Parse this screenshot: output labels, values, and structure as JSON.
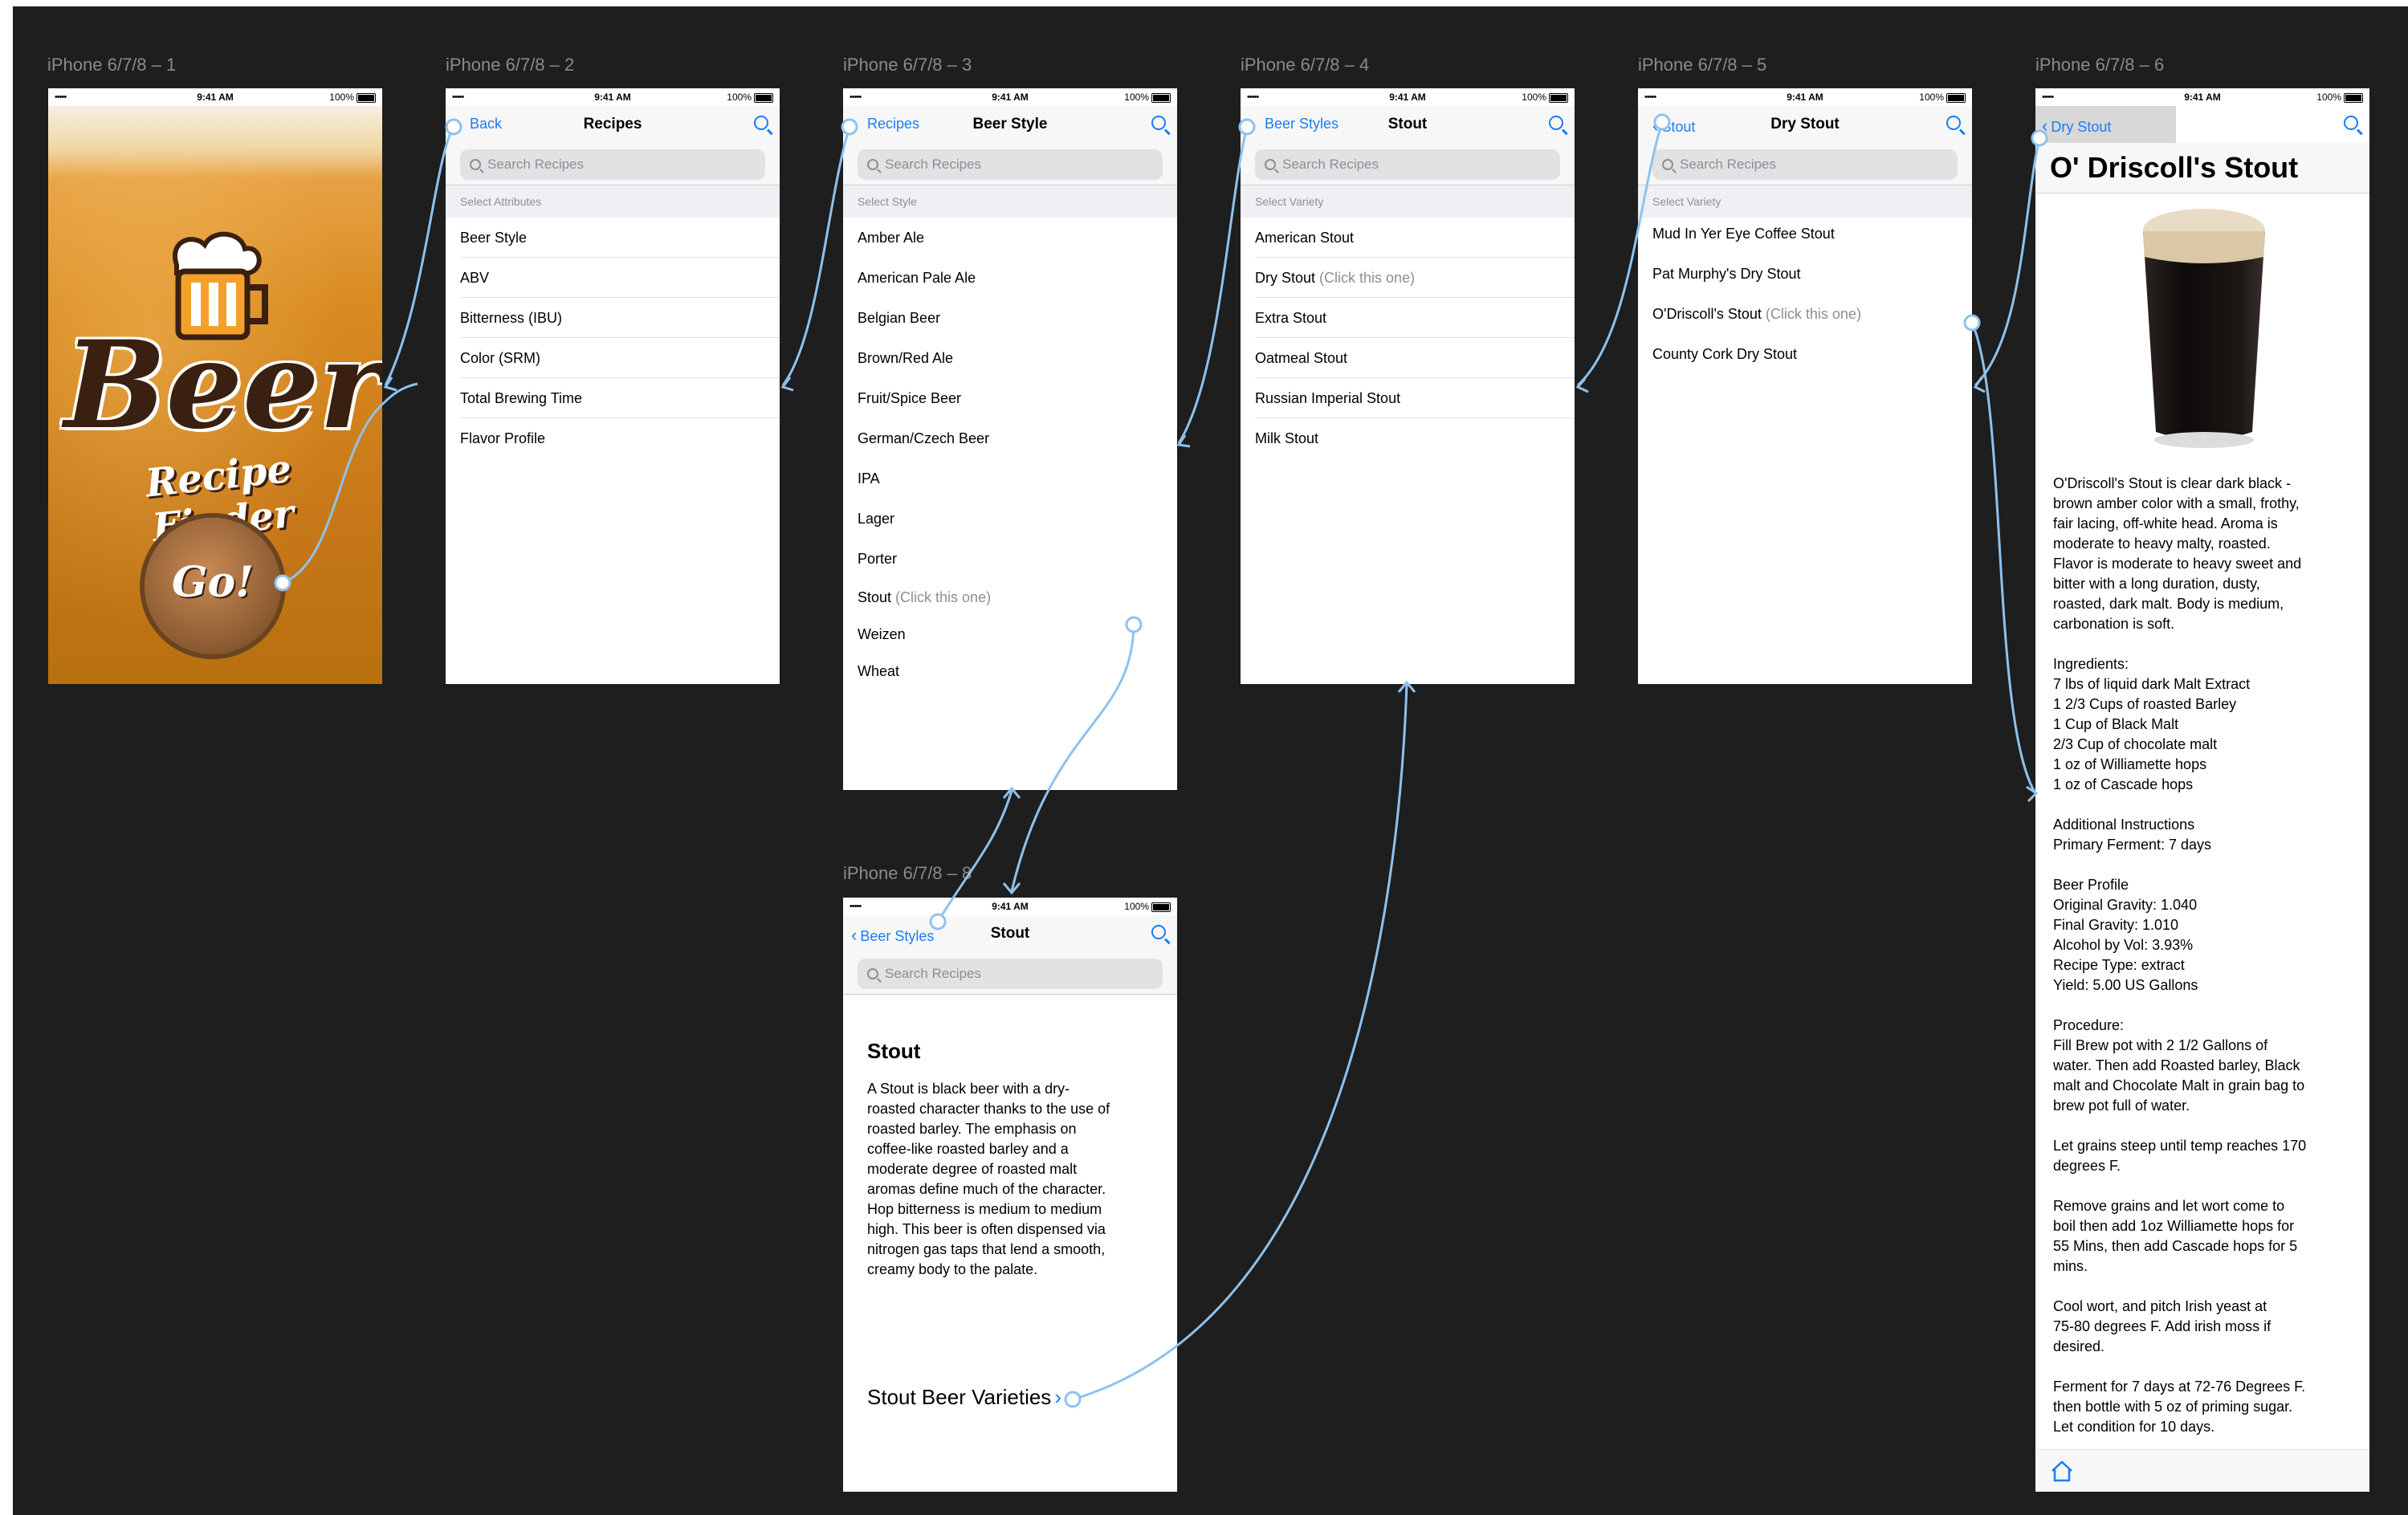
{
  "artboards": {
    "a1": "iPhone 6/7/8 – 1",
    "a2": "iPhone 6/7/8 – 2",
    "a3": "iPhone 6/7/8 – 3",
    "a4": "iPhone 6/7/8 – 4",
    "a5": "iPhone 6/7/8 – 5",
    "a6": "iPhone 6/7/8 – 6",
    "a8": "iPhone 6/7/8 – 8"
  },
  "status": {
    "time": "9:41 AM",
    "battery": "100%",
    "signal": "•••••"
  },
  "search_placeholder": "Search Recipes",
  "splash": {
    "logo_word": "Beer",
    "tagline": "Recipe Finder",
    "go_label": "Go!"
  },
  "screen2": {
    "back": "Back",
    "title": "Recipes",
    "section": "Select Attributes",
    "items": [
      "Beer Style",
      "ABV",
      "Bitterness (IBU)",
      "Color (SRM)",
      "Total Brewing Time",
      "Flavor Profile"
    ]
  },
  "screen3": {
    "back": "Recipes",
    "title": "Beer Style",
    "section": "Select Style",
    "items": [
      "Amber Ale",
      "American Pale Ale",
      "Belgian Beer",
      "Brown/Red Ale",
      "Fruit/Spice Beer",
      "German/Czech Beer",
      "IPA",
      "Lager",
      "Porter",
      "Stout",
      "Weizen",
      "Wheat"
    ],
    "stout_hint": "(Click this one)"
  },
  "screen4": {
    "back": "Beer Styles",
    "title": "Stout",
    "section": "Select Variety",
    "items": [
      "American Stout",
      "Dry Stout",
      "Extra Stout",
      "Oatmeal Stout",
      "Russian Imperial Stout",
      "Milk Stout"
    ],
    "dry_hint": "(Click this one)"
  },
  "screen5": {
    "back": "Stout",
    "title": "Dry Stout",
    "section": "Select Variety",
    "items": [
      "Mud In Yer Eye Coffee Stout",
      "Pat Murphy's Dry Stout",
      "O'Driscoll's Stout",
      "County Cork Dry Stout"
    ],
    "odriscoll_hint": "(Click this one)"
  },
  "screen6": {
    "back": "Dry Stout",
    "title": "O' Driscoll's Stout",
    "body": "O'Driscoll's Stout is clear dark black -\nbrown amber color with a small, frothy,\nfair lacing, off-white head. Aroma is\nmoderate to heavy malty, roasted.\nFlavor is moderate to heavy sweet and\nbitter with a long duration, dusty,\nroasted, dark malt. Body is medium,\ncarbonation is soft.\n\nIngredients:\n7 lbs of liquid dark Malt Extract\n1 2/3 Cups of roasted Barley\n1 Cup of Black Malt\n2/3 Cup of chocolate malt\n1 oz of Williamette hops\n1 oz of Cascade hops\n\nAdditional Instructions\nPrimary Ferment: 7 days\n\nBeer Profile\nOriginal Gravity: 1.040\nFinal Gravity: 1.010\nAlcohol by Vol: 3.93%\nRecipe Type: extract\nYield: 5.00 US Gallons\n\nProcedure:\nFill Brew pot with 2 1/2 Gallons of\nwater. Then add Roasted barley, Black\nmalt and Chocolate Malt in grain bag to\nbrew pot full of water.\n\nLet grains steep until temp reaches 170\ndegrees F.\n\nRemove grains and let wort come to\nboil then add 1oz Williamette hops for\n55 Mins, then add Cascade hops for 5\nmins.\n\nCool wort, and pitch Irish yeast at\n75-80 degrees F. Add irish moss if\ndesired.\n\nFerment for 7 days at 72-76 Degrees F.\nthen bottle with 5 oz of priming sugar.\nLet condition for 10 days."
  },
  "screen8": {
    "back": "Beer Styles",
    "title": "Stout",
    "heading": "Stout",
    "body": "A Stout is black beer with a dry-\nroasted character thanks to the use of\nroasted barley. The emphasis on\ncoffee-like roasted barley and a\nmoderate degree of roasted malt\naromas define much of the character.\nHop bitterness is medium to medium\nhigh. This beer is often dispensed via\nnitrogen gas taps that lend a smooth,\ncreamy body to the palate.",
    "varieties_link": "Stout Beer Varieties"
  },
  "colors": {
    "canvas": "#1e1e1e",
    "accent": "#1a7cf5",
    "wire": "#8ec2ee"
  }
}
